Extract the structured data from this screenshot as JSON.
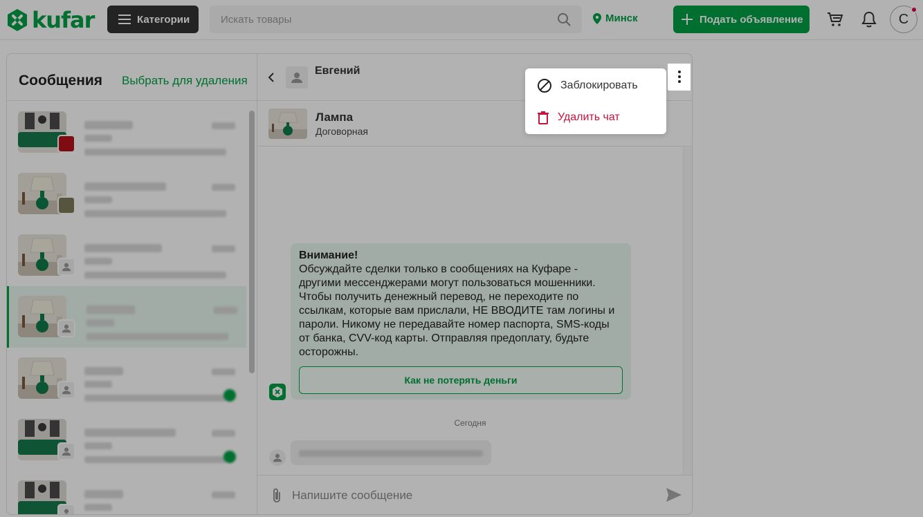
{
  "header": {
    "logo_text": "kufar",
    "categories_label": "Категории",
    "search_placeholder": "Искать товары",
    "city": "Минск",
    "post_ad_label": "Подать объявление",
    "user_initial": "С",
    "icons": [
      "kufar-logo-icon",
      "hamburger-icon",
      "search-icon",
      "location-pin-icon",
      "plus-icon",
      "cart-icon",
      "bell-icon"
    ]
  },
  "messages_panel": {
    "title": "Сообщения",
    "select_for_delete": "Выбрать для удаления",
    "conversations": [
      {
        "thumb": "sofa",
        "active": false,
        "unread": false
      },
      {
        "thumb": "lamp",
        "active": false,
        "unread": false
      },
      {
        "thumb": "lamp",
        "active": false,
        "unread": false
      },
      {
        "thumb": "lamp",
        "active": true,
        "unread": false
      },
      {
        "thumb": "lamp",
        "active": false,
        "unread": true
      },
      {
        "thumb": "sofa",
        "active": false,
        "unread": true
      },
      {
        "thumb": "sofa",
        "active": false,
        "unread": false
      }
    ]
  },
  "chat": {
    "user_name": "Евгений",
    "item_name": "Лампа",
    "item_price": "Договорная",
    "warning_title": "Внимание!",
    "warning_text": "Обсуждайте сделки только в сообщениях на Куфаре - другими мессенджерами могут пользоваться мошенники. Чтобы получить денежный перевод, не переходите по ссылкам, которые вам прислали, НЕ ВВОДИТЕ там логины и пароли. Никому не передавайте номер паспорта, SMS-коды от банка, CVV-код карты. Отправляя предоплату, будьте осторожны.",
    "warning_button": "Как не потерять деньги",
    "date_divider": "Сегодня",
    "input_placeholder": "Напишите сообщение"
  },
  "dropdown_menu": {
    "block_label": "Заблокировать",
    "delete_label": "Удалить чат",
    "accent_delete": "#c8113d"
  },
  "colors": {
    "brand_green": "#00a046",
    "notification_dot": "#e3004f",
    "dark_button": "#333333"
  }
}
